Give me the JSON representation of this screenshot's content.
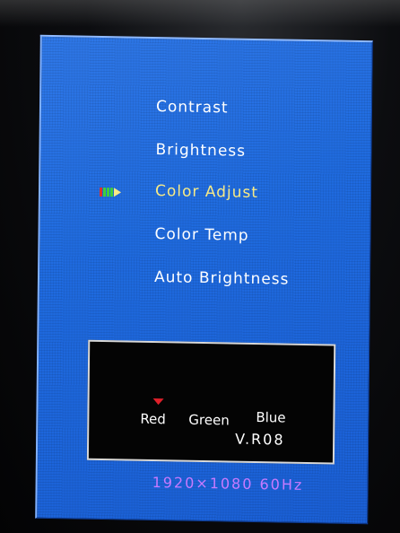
{
  "osd": {
    "menu": [
      {
        "label": "Contrast",
        "selected": false
      },
      {
        "label": "Brightness",
        "selected": false
      },
      {
        "label": "Color  Adjust",
        "selected": true
      },
      {
        "label": "Color  Temp",
        "selected": false
      },
      {
        "label": "Auto  Brightness",
        "selected": false
      }
    ],
    "selector_icon": "double-arrow-selector-icon",
    "info_panel": {
      "channels": [
        "Red",
        "Green",
        "Blue"
      ],
      "selected_channel": "Red",
      "version": "V.R08"
    },
    "resolution": "1920×1080  60Hz"
  },
  "colors": {
    "background": "#1f6be0",
    "menu_text": "#ffffff",
    "selected_text": "#f7ea86",
    "panel_bg": "#040404",
    "marker": "#e0202a",
    "resolution_text": "#c77aff"
  }
}
